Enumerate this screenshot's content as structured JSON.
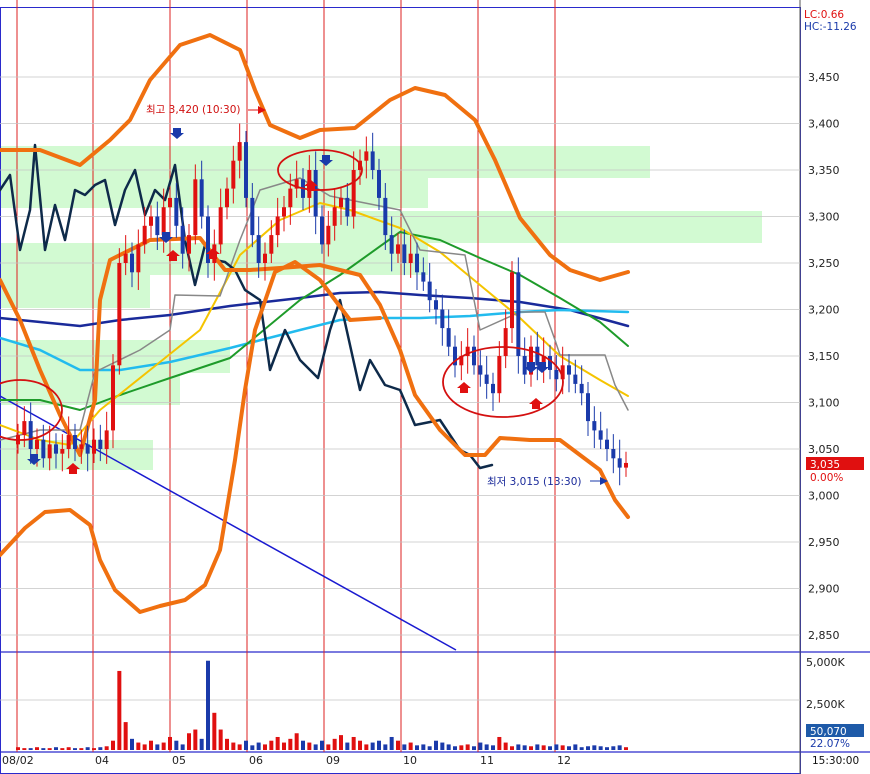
{
  "indicators": {
    "lc": "LC:0.66",
    "hc": "HC:-11.26"
  },
  "price_panel": {
    "current_price": "3,035",
    "change_pct": "0.00%",
    "high_annotation": "최고 3,420 (10:30)",
    "low_annotation": "최저 3,015 (13:30)"
  },
  "volume_panel": {
    "current_volume": "50,070",
    "volume_pct": "22.07%"
  },
  "time_label": "15:30:00",
  "colors": {
    "bollinger": "#f07010",
    "ma_yellow": "#f5c400",
    "ma_green": "#1e9b2a",
    "ma_blue": "#1a2a9a",
    "ma_cyan": "#22bbee",
    "navy_line": "#0e2a4a",
    "gray_line": "#888888",
    "up": "#e01010",
    "down": "#1a3aaa",
    "zone": "#d2fad2",
    "grid_red": "#dc2020",
    "grid_blue": "#2a2acc",
    "trend": "#1a1ad0",
    "ellipse": "#d41010",
    "price_box_bg": "#e01010",
    "volume_box_bg": "#1e5aa8"
  },
  "chart_data": {
    "type": "candlestick",
    "y_axis": {
      "range": [
        2830,
        3500
      ],
      "ticks": [
        "3,450",
        "3,400",
        "3,350",
        "3,300",
        "3,250",
        "3,200",
        "3,150",
        "3,100",
        "3,050",
        "3,000",
        "2,950",
        "2,900",
        "2,850"
      ]
    },
    "x_axis": {
      "date_labels": [
        "08/02",
        "04",
        "05",
        "06",
        "09",
        "10",
        "11",
        "12"
      ]
    },
    "volume_axis": {
      "ticks": [
        "5,000K",
        "2,500K"
      ]
    },
    "series": [
      {
        "values": [
          3065,
          3080,
          3050,
          3060,
          3040,
          3055,
          3045,
          3050,
          3065,
          3050,
          3055,
          3045,
          3060,
          3050,
          3070,
          3140,
          3250,
          3260,
          3240,
          3270,
          3290,
          3300,
          3280,
          3310,
          3320,
          3290,
          3260,
          3280,
          3340,
          3300,
          3250,
          3270,
          3310,
          3330,
          3360,
          3380,
          3320,
          3280,
          3250,
          3260,
          3280,
          3300,
          3310,
          3330,
          3340,
          3320,
          3350,
          3300,
          3270,
          3290,
          3310,
          3320,
          3300,
          3350,
          3360,
          3370,
          3350,
          3320,
          3280,
          3260,
          3270,
          3250,
          3260,
          3240,
          3230,
          3210,
          3200,
          3180,
          3160,
          3140,
          3150,
          3160,
          3140,
          3130,
          3120,
          3110,
          3150,
          3180,
          3240,
          3150,
          3130,
          3160,
          3140,
          3150,
          3135,
          3125,
          3140,
          3130,
          3120,
          3110,
          3080,
          3070,
          3060,
          3050,
          3040,
          3030,
          3035
        ]
      }
    ]
  }
}
